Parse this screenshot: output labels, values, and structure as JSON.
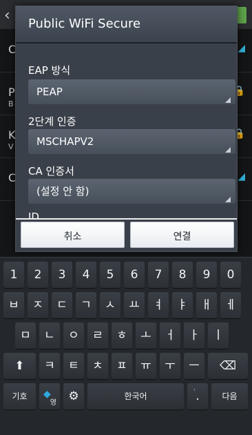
{
  "dialog": {
    "title": "Public WiFi Secure",
    "fields": [
      {
        "label": "EAP 방식",
        "value": "PEAP"
      },
      {
        "label": "2단계 인증",
        "value": "MSCHAPV2"
      },
      {
        "label": "CA 인증서",
        "value": "(설정 안 함)"
      },
      {
        "label": "ID",
        "value": ""
      }
    ],
    "buttons": {
      "cancel": "취소",
      "connect": "연결"
    }
  },
  "background": {
    "letters": [
      "C",
      "P",
      "K",
      "C"
    ],
    "subletters": [
      "B",
      "V"
    ]
  },
  "keyboard": {
    "row1": [
      "1",
      "2",
      "3",
      "4",
      "5",
      "6",
      "7",
      "8",
      "9",
      "0"
    ],
    "row2": [
      "ㅂ",
      "ㅈ",
      "ㄷ",
      "ㄱ",
      "ㅅ",
      "ㅛ",
      "ㅕ",
      "ㅑ",
      "ㅐ",
      "ㅔ"
    ],
    "row3": [
      "ㅁ",
      "ㄴ",
      "ㅇ",
      "ㄹ",
      "ㅎ",
      "ㅗ",
      "ㅓ",
      "ㅏ",
      "ㅣ"
    ],
    "row4": [
      "ㅋ",
      "ㅌ",
      "ㅊ",
      "ㅍ",
      "ㅠ",
      "ㅜ",
      "ㅡ"
    ],
    "symbols": "기호",
    "lang_switch": "한국어",
    "next": "다음",
    "period": ".",
    "comma": "'",
    "en_mark": "영"
  }
}
